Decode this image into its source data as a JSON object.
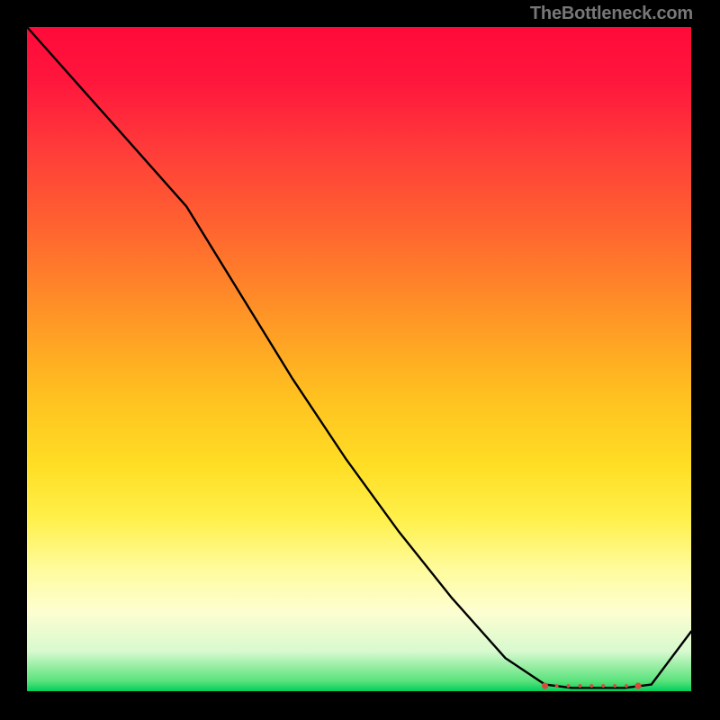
{
  "watermark": "TheBottleneck.com",
  "chart_data": {
    "type": "line",
    "title": "",
    "xlabel": "",
    "ylabel": "",
    "x": [
      0.0,
      0.08,
      0.16,
      0.24,
      0.32,
      0.4,
      0.48,
      0.56,
      0.64,
      0.72,
      0.78,
      0.82,
      0.86,
      0.9,
      0.94,
      1.0
    ],
    "values": [
      1.0,
      0.91,
      0.82,
      0.73,
      0.6,
      0.47,
      0.35,
      0.24,
      0.14,
      0.05,
      0.01,
      0.005,
      0.005,
      0.005,
      0.01,
      0.09
    ],
    "xlim": [
      0,
      1
    ],
    "ylim": [
      0,
      1
    ],
    "grid": false,
    "annotations": {
      "trough_marker": {
        "x_start": 0.78,
        "x_end": 0.92,
        "y": 0.008,
        "style": "scatter-red"
      }
    },
    "background": {
      "kind": "vertical-gradient",
      "stops": [
        {
          "pos": 0.0,
          "color": "#ff0a3a"
        },
        {
          "pos": 0.55,
          "color": "#ffbf20"
        },
        {
          "pos": 0.82,
          "color": "#fffca0"
        },
        {
          "pos": 0.98,
          "color": "#58e27a"
        },
        {
          "pos": 1.0,
          "color": "#00cf5c"
        }
      ]
    }
  }
}
